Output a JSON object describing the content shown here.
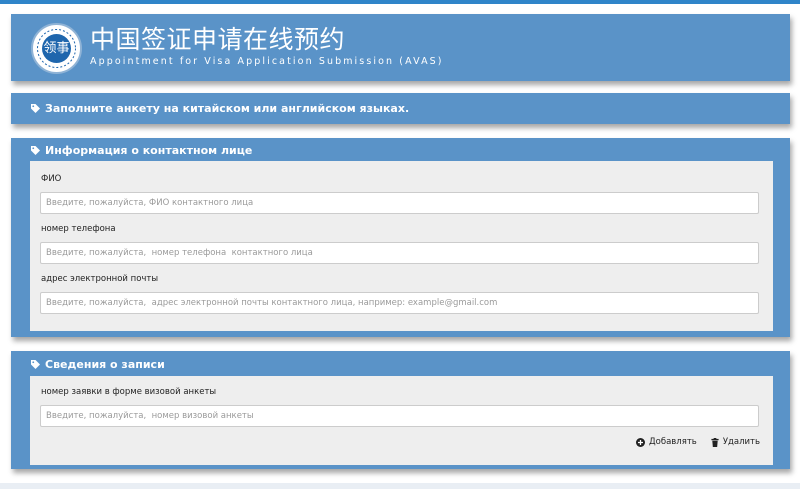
{
  "header": {
    "title_cn": "中国签证申请在线预约",
    "title_en": "Appointment for Visa Application Submission (AVAS)",
    "logo_text": "领事"
  },
  "notice": {
    "text": "Заполните анкету на китайском или английском языках."
  },
  "contact": {
    "title": "Информация о контактном лице",
    "fields": [
      {
        "label": "ФИО",
        "placeholder": "Введите, пожалуйста, ФИО контактного лица",
        "value": ""
      },
      {
        "label": "номер телефона",
        "placeholder": "Введите, пожалуйста,  номер телефона  контактного лица",
        "value": ""
      },
      {
        "label": "адрес электронной почты",
        "placeholder": "Введите, пожалуйста,  адрес электронной почты контактного лица, например: example@gmail.com",
        "value": ""
      }
    ]
  },
  "record": {
    "title": "Сведения о записи",
    "field": {
      "label": "номер заявки в форме визовой анкеты",
      "placeholder": "Введите, пожалуйста,  номер визовой анкеты",
      "value": ""
    },
    "add_label": "Добавлять",
    "delete_label": "Удалить"
  },
  "colors": {
    "panel": "#5a93c8",
    "inner": "#eeeeee",
    "accent": "#2f85c9"
  },
  "icons": {
    "section": "tag-icon",
    "add": "plus-circle-icon",
    "delete": "trash-icon"
  }
}
